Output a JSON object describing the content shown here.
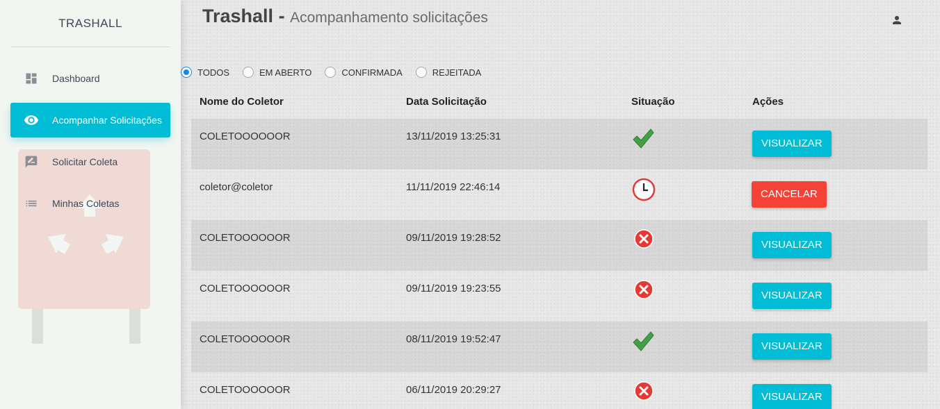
{
  "sidebar": {
    "brand": "TRASHALL",
    "items": [
      {
        "label": "Dashboard",
        "icon": "dashboard-icon",
        "active": false
      },
      {
        "label": "Acompanhar Solicitações",
        "icon": "eye-icon",
        "active": true
      },
      {
        "label": "Solicitar Coleta",
        "icon": "rate-review-icon",
        "active": false
      },
      {
        "label": "Minhas Coletas",
        "icon": "list-icon",
        "active": false
      }
    ]
  },
  "header": {
    "app_name": "Trashall",
    "separator": " - ",
    "subtitle": "Acompanhamento solicitações",
    "user_icon": "person-icon"
  },
  "filters": {
    "options": [
      "TODOS",
      "EM ABERTO",
      "CONFIRMADA",
      "REJEITADA"
    ],
    "selected": "TODOS"
  },
  "table": {
    "columns": [
      "Nome do Coletor",
      "Data Solicitação",
      "Situação",
      "Ações"
    ],
    "rows": [
      {
        "collector": "COLETOOOOOOR",
        "date": "13/11/2019 13:25:31",
        "status": "confirmed",
        "action": "VISUALIZAR"
      },
      {
        "collector": "coletor@coletor",
        "date": "11/11/2019 22:46:14",
        "status": "open",
        "action": "CANCELAR"
      },
      {
        "collector": "COLETOOOOOOR",
        "date": "09/11/2019 19:28:52",
        "status": "rejected",
        "action": "VISUALIZAR"
      },
      {
        "collector": "COLETOOOOOOR",
        "date": "09/11/2019 19:23:55",
        "status": "rejected",
        "action": "VISUALIZAR"
      },
      {
        "collector": "COLETOOOOOOR",
        "date": "08/11/2019 19:52:47",
        "status": "confirmed",
        "action": "VISUALIZAR"
      },
      {
        "collector": "COLETOOOOOOR",
        "date": "06/11/2019 20:29:27",
        "status": "rejected",
        "action": "VISUALIZAR"
      }
    ]
  },
  "colors": {
    "accent": "#00bcd4",
    "danger": "#f44336",
    "confirmed": "#43a047",
    "radio_selected": "#1e88e5"
  }
}
